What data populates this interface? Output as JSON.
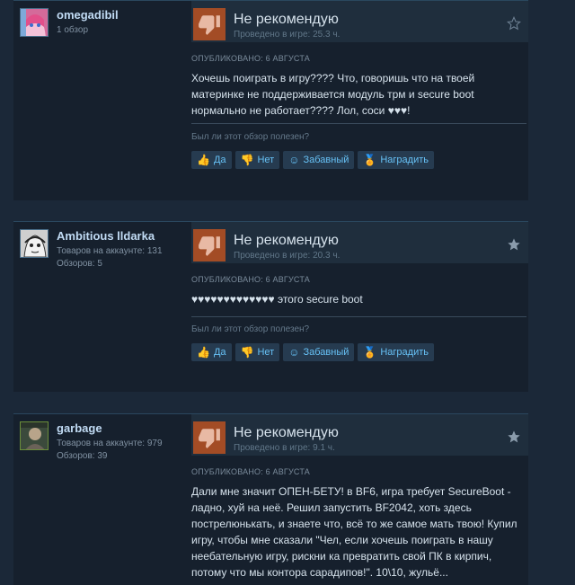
{
  "reviews": [
    {
      "author": {
        "name": "omegadibil",
        "stats": [
          "1 обзор"
        ],
        "avatar": "anime-avatar"
      },
      "verdict": "Не рекомендую",
      "hours": "Проведено в игре: 25.3 ч.",
      "posted": "ОПУБЛИКОВАНО: 6 АВГУСТА",
      "text": "Хочешь поиграть в игру???? Что, говоришь что на твоей материнке не поддерживается модуль трм и secure boot нормально не работает???? Лол, соси ♥♥♥!",
      "helpful_question": "Был ли этот обзор полезен?",
      "buttons": {
        "yes": "Да",
        "no": "Нет",
        "funny": "Забавный",
        "award": "Наградить"
      }
    },
    {
      "author": {
        "name": "Ambitious lldarka",
        "stats": [
          "Товаров на аккаунте: 131",
          "Обзоров: 5"
        ],
        "avatar": "manga-avatar"
      },
      "verdict": "Не рекомендую",
      "hours": "Проведено в игре: 20.3 ч.",
      "posted": "ОПУБЛИКОВАНО: 6 АВГУСТА",
      "text": "♥♥♥♥♥♥♥♥♥♥♥♥♥ этого secure boot",
      "helpful_question": "Был ли этот обзор полезен?",
      "buttons": {
        "yes": "Да",
        "no": "Нет",
        "funny": "Забавный",
        "award": "Наградить"
      }
    },
    {
      "author": {
        "name": "garbage",
        "stats": [
          "Товаров на аккаунте: 979",
          "Обзоров: 39"
        ],
        "avatar": "photo-avatar"
      },
      "verdict": "Не рекомендую",
      "hours": "Проведено в игре: 9.1 ч.",
      "posted": "ОПУБЛИКОВАНО: 6 АВГУСТА",
      "text": "Дали мне значит ОПЕН-БЕТУ! в BF6, игра требует SecureBoot - ладно, хуй на неё. Решил запустить BF2042, хоть здесь пострелюнькать, и знаете что, всё то же самое мать твою! Купил игру, чтобы мне сказали \"Чел, если хочешь поиграть в нашу неебательную игру, рискни ка превратить свой ПК в кирпич, потому что мы контора сарадипов!\". 10\\10, жульё..."
    }
  ],
  "colors": {
    "background": "#1b2838",
    "card": "#16202d",
    "thumb_down": "#a34c25",
    "link": "#66c0f4"
  }
}
